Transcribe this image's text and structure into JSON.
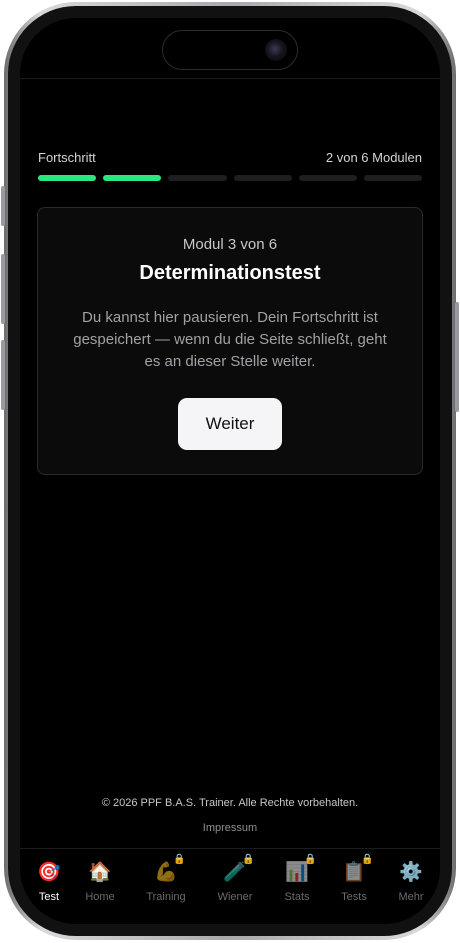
{
  "progress": {
    "label": "Fortschritt",
    "status": "2 von 6 Modulen",
    "completed": 2,
    "total": 6,
    "accent_color": "#2ee67f"
  },
  "card": {
    "module_label": "Modul 3 von 6",
    "title": "Determinationstest",
    "description": "Du kannst hier pausieren. Dein Fortschritt ist gespeichert — wenn du die Seite schließt, geht es an dieser Stelle weiter.",
    "button_label": "Weiter"
  },
  "footer": {
    "copyright": "© 2026 PPF B.A.S. Trainer. Alle Rechte vorbehalten.",
    "impressum": "Impressum"
  },
  "tabs": [
    {
      "label": "Test",
      "icon": "🎯",
      "icon_name": "dart-target-icon",
      "active": true,
      "locked": false
    },
    {
      "label": "Home",
      "icon": "🏠",
      "icon_name": "house-icon",
      "active": false,
      "locked": false
    },
    {
      "label": "Training",
      "icon": "💪",
      "icon_name": "flexed-biceps-icon",
      "active": false,
      "locked": true
    },
    {
      "label": "Wiener",
      "icon": "🧪",
      "icon_name": "test-tube-icon",
      "active": false,
      "locked": true
    },
    {
      "label": "Stats",
      "icon": "📊",
      "icon_name": "bar-chart-icon",
      "active": false,
      "locked": true
    },
    {
      "label": "Tests",
      "icon": "📋",
      "icon_name": "clipboard-icon",
      "active": false,
      "locked": true
    },
    {
      "label": "Mehr",
      "icon": "⚙️",
      "icon_name": "gear-icon",
      "active": false,
      "locked": false
    }
  ],
  "lock_icon": "🔒"
}
